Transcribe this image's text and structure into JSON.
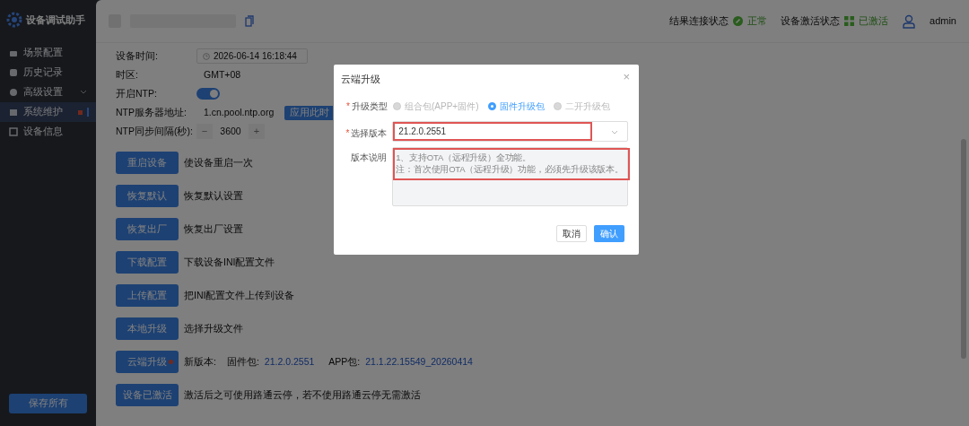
{
  "app": {
    "title": "设备调试助手"
  },
  "sidebar": {
    "items": [
      {
        "label": "场景配置",
        "selected": false,
        "expandable": false,
        "alert": false
      },
      {
        "label": "历史记录",
        "selected": false,
        "expandable": false,
        "alert": false
      },
      {
        "label": "高级设置",
        "selected": false,
        "expandable": true,
        "alert": false
      },
      {
        "label": "系统维护",
        "selected": true,
        "expandable": false,
        "alert": true
      },
      {
        "label": "设备信息",
        "selected": false,
        "expandable": false,
        "alert": false
      }
    ],
    "save_button": "保存所有"
  },
  "header": {
    "status": [
      {
        "label": "结果连接状态",
        "value": "正常",
        "kind": "link"
      },
      {
        "label": "设备激活状态",
        "value": "已激活",
        "kind": "grid"
      }
    ],
    "user": "admin"
  },
  "settings": [
    {
      "label": "设备时间:",
      "kind": "datetime",
      "value": "2026-06-14 16:18:44"
    },
    {
      "label": "时区:",
      "kind": "text",
      "value": "GMT+08"
    },
    {
      "label": "开启NTP:",
      "kind": "switch",
      "on": true
    },
    {
      "label": "NTP服务器地址:",
      "kind": "text",
      "value": "1.cn.pool.ntp.org",
      "button": "应用此时"
    },
    {
      "label": "NTP同步间隔(秒):",
      "kind": "stepper",
      "value": "3600",
      "minus": "−",
      "plus": "+"
    }
  ],
  "actions": [
    {
      "button": "重启设备",
      "desc": "使设备重启一次",
      "badge": false
    },
    {
      "button": "恢复默认",
      "desc": "恢复默认设置",
      "badge": false
    },
    {
      "button": "恢复出厂",
      "desc": "恢复出厂设置",
      "badge": false
    },
    {
      "button": "下载配置",
      "desc": "下载设备INI配置文件",
      "badge": false
    },
    {
      "button": "上传配置",
      "desc": "把INI配置文件上传到设备",
      "badge": false
    },
    {
      "button": "本地升级",
      "desc": "选择升级文件",
      "badge": false
    },
    {
      "button": "云端升级",
      "badge": true,
      "versions": [
        {
          "text": "新版本:",
          "kind": "label"
        },
        {
          "text": "固件包:",
          "kind": "label"
        },
        {
          "text": "21.2.0.2551",
          "kind": "value"
        },
        {
          "text": "APP包:",
          "kind": "label"
        },
        {
          "text": "21.1.22.15549_20260414",
          "kind": "value"
        }
      ]
    },
    {
      "button": "设备已激活",
      "desc": "激活后之可使用路通云停，若不使用路通云停无需激活",
      "badge": false
    }
  ],
  "dialog": {
    "title": "云端升级",
    "close": "×",
    "type": {
      "label": "升级类型",
      "marker": "*",
      "options": [
        {
          "label": "组合包(APP+固件)",
          "selected": false,
          "disabled": true
        },
        {
          "label": "固件升级包",
          "selected": true,
          "disabled": false
        },
        {
          "label": "二开升级包",
          "selected": false,
          "disabled": true
        }
      ]
    },
    "version": {
      "label": "选择版本",
      "marker": "*",
      "value": "21.2.0.2551",
      "highlighted": true
    },
    "notes": {
      "label": "版本说明",
      "lines": [
        "1、支持OTA（远程升级）全功能。",
        "注：首次使用OTA（远程升级）功能，必须先升级该版本。"
      ],
      "highlighted": true
    },
    "buttons": [
      {
        "label": "取消",
        "kind": "secondary"
      },
      {
        "label": "确认",
        "kind": "primary"
      }
    ]
  }
}
